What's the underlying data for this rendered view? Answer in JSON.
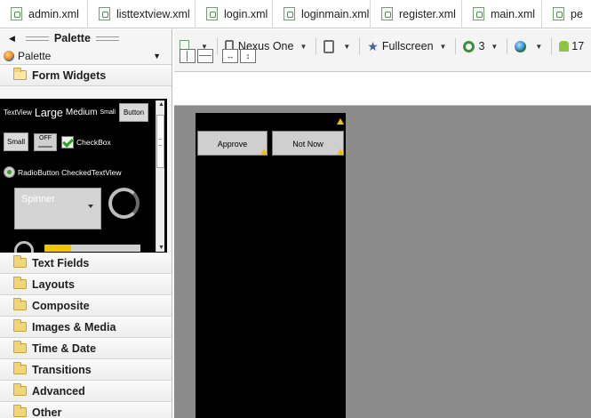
{
  "tabs": [
    {
      "label": "admin.xml"
    },
    {
      "label": "listtextview.xml"
    },
    {
      "label": "login.xml"
    },
    {
      "label": "loginmain.xml"
    },
    {
      "label": "register.xml"
    },
    {
      "label": "main.xml"
    },
    {
      "label": "pe"
    }
  ],
  "palette": {
    "title": "Palette",
    "selector": "Palette",
    "open_category": "Form Widgets",
    "widgets": {
      "textview": "TextView",
      "large": "Large",
      "medium": "Medium",
      "small_text": "Small",
      "button": "Button",
      "small_button": "Small",
      "toggle": "OFF",
      "checkbox": "CheckBox",
      "radio": "RadioButton CheckedTextView",
      "spinner": "Spinner",
      "progress_fraction": 0.28
    },
    "categories": [
      {
        "label": "Text Fields"
      },
      {
        "label": "Layouts"
      },
      {
        "label": "Composite"
      },
      {
        "label": "Images & Media"
      },
      {
        "label": "Time & Date"
      },
      {
        "label": "Transitions"
      },
      {
        "label": "Advanced"
      },
      {
        "label": "Other"
      }
    ]
  },
  "toolbar": {
    "device": "Nexus One",
    "fullscreen": "Fullscreen",
    "theme": "3",
    "api": "17"
  },
  "canvas": {
    "approve": "Approve",
    "not_now": "Not Now"
  },
  "colors": {
    "warning": "#f2c200",
    "canvas_bg": "#8b8b8b",
    "device_bg": "#000000"
  }
}
